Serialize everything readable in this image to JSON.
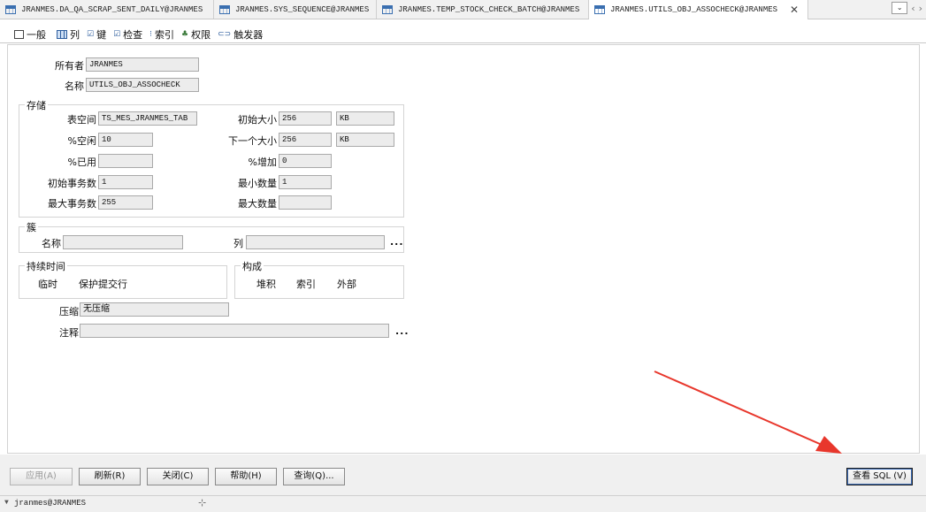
{
  "doc_tabs": [
    {
      "label": "JRANMES.DA_QA_SCRAP_SENT_DAILY@JRANMES"
    },
    {
      "label": "JRANMES.SYS_SEQUENCE@JRANMES"
    },
    {
      "label": "JRANMES.TEMP_STOCK_CHECK_BATCH@JRANMES"
    },
    {
      "label": "JRANMES.UTILS_OBJ_ASSOCHECK@JRANMES"
    }
  ],
  "section_tabs": [
    {
      "label": "一般",
      "icon": "general-icon"
    },
    {
      "label": "列",
      "icon": "columns-icon"
    },
    {
      "label": "键",
      "icon": "keys-icon"
    },
    {
      "label": "检查",
      "icon": "checks-icon"
    },
    {
      "label": "索引",
      "icon": "indexes-icon"
    },
    {
      "label": "权限",
      "icon": "privileges-icon"
    },
    {
      "label": "触发器",
      "icon": "triggers-icon"
    }
  ],
  "general": {
    "owner_label": "所有者",
    "owner_value": "JRANMES",
    "name_label": "名称",
    "name_value": "UTILS_OBJ_ASSOCHECK"
  },
  "storage": {
    "title": "存储",
    "tablespace_label": "表空间",
    "tablespace_value": "TS_MES_JRANMES_TAB",
    "pct_free_label": "%空闲",
    "pct_free_value": "10",
    "pct_used_label": "%已用",
    "pct_used_value": "",
    "ini_trans_label": "初始事务数",
    "ini_trans_value": "1",
    "max_trans_label": "最大事务数",
    "max_trans_value": "255",
    "initial_label": "初始大小",
    "initial_value": "256",
    "initial_unit": "KB",
    "next_label": "下一个大小",
    "next_value": "256",
    "next_unit": "KB",
    "pct_increase_label": "%增加",
    "pct_increase_value": "0",
    "min_extents_label": "最小数量",
    "min_extents_value": "1",
    "max_extents_label": "最大数量",
    "max_extents_value": ""
  },
  "cluster": {
    "title": "簇",
    "name_label": "名称",
    "name_value": "",
    "columns_label": "列",
    "columns_value": "",
    "ellipsis": "..."
  },
  "duration": {
    "title": "持续时间",
    "temporary_label": "临时",
    "preserve_label": "保护提交行"
  },
  "organization": {
    "title": "构成",
    "heap_label": "堆积",
    "index_label": "索引",
    "external_label": "外部"
  },
  "compress_label": "压缩",
  "compress_value": "无压缩",
  "comment_label": "注释",
  "comment_value": "",
  "comment_ellipsis": "...",
  "buttons": {
    "apply": "应用(A)",
    "refresh": "刷新(R)",
    "close": "关闭(C)",
    "help": "帮助(H)",
    "query": "查询(Q)...",
    "view_sql": "查看 SQL (V)"
  },
  "status": {
    "connection": "jranmes@JRANMES"
  },
  "colors": {
    "annotation_arrow": "#e8372c"
  }
}
